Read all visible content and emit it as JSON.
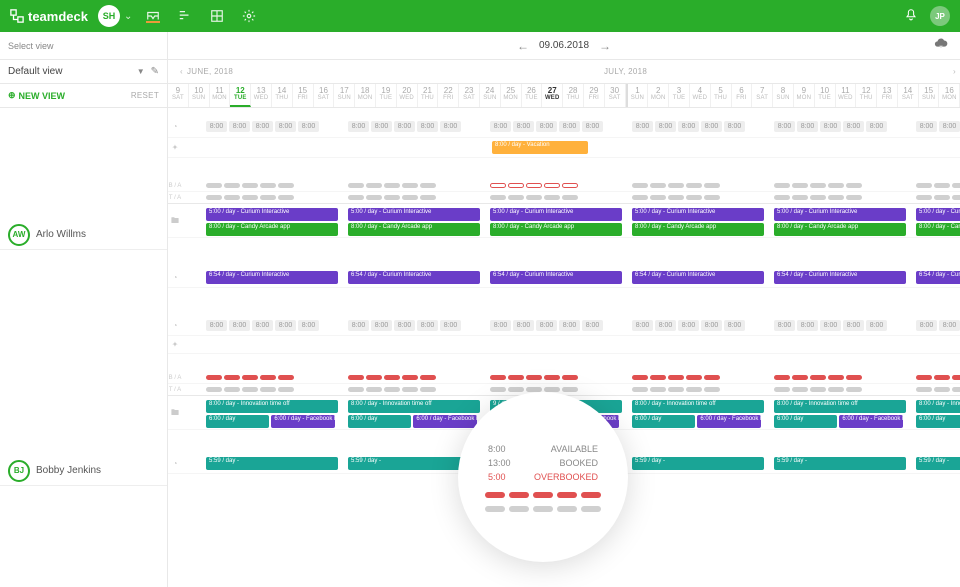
{
  "app": {
    "name": "teamdeck",
    "user_initials": "SH",
    "right_initials": "JP"
  },
  "dateNav": {
    "current": "09.06.2018"
  },
  "view": {
    "selectLabel": "Select view",
    "current": "Default view",
    "newView": "NEW VIEW",
    "reset": "RESET"
  },
  "months": {
    "june": "JUNE, 2018",
    "july": "JULY, 2018"
  },
  "days": [
    {
      "n": "9",
      "d": "SAT"
    },
    {
      "n": "10",
      "d": "SUN"
    },
    {
      "n": "11",
      "d": "MON"
    },
    {
      "n": "12",
      "d": "TUE",
      "today": true
    },
    {
      "n": "13",
      "d": "WED"
    },
    {
      "n": "14",
      "d": "THU"
    },
    {
      "n": "15",
      "d": "FRI"
    },
    {
      "n": "16",
      "d": "SAT"
    },
    {
      "n": "17",
      "d": "SUN"
    },
    {
      "n": "18",
      "d": "MON"
    },
    {
      "n": "19",
      "d": "TUE"
    },
    {
      "n": "20",
      "d": "WED"
    },
    {
      "n": "21",
      "d": "THU"
    },
    {
      "n": "22",
      "d": "FRI"
    },
    {
      "n": "23",
      "d": "SAT"
    },
    {
      "n": "24",
      "d": "SUN"
    },
    {
      "n": "25",
      "d": "MON"
    },
    {
      "n": "26",
      "d": "TUE"
    },
    {
      "n": "27",
      "d": "WED",
      "hl": true
    },
    {
      "n": "28",
      "d": "THU"
    },
    {
      "n": "29",
      "d": "FRI"
    },
    {
      "n": "30",
      "d": "SAT"
    },
    {
      "n": "1",
      "d": "SUN",
      "mstart": true
    },
    {
      "n": "2",
      "d": "MON"
    },
    {
      "n": "3",
      "d": "TUE"
    },
    {
      "n": "4",
      "d": "WED"
    },
    {
      "n": "5",
      "d": "THU"
    },
    {
      "n": "6",
      "d": "FRI"
    },
    {
      "n": "7",
      "d": "SAT"
    },
    {
      "n": "8",
      "d": "SUN"
    },
    {
      "n": "9",
      "d": "MON"
    },
    {
      "n": "10",
      "d": "TUE"
    },
    {
      "n": "11",
      "d": "WED"
    },
    {
      "n": "12",
      "d": "THU"
    },
    {
      "n": "13",
      "d": "FRI"
    },
    {
      "n": "14",
      "d": "SAT"
    },
    {
      "n": "15",
      "d": "SUN"
    },
    {
      "n": "16",
      "d": "MON"
    }
  ],
  "people": [
    {
      "initials": "AW",
      "name": "Arlo Willms",
      "color": "#2aad2a"
    },
    {
      "initials": "BJ",
      "name": "Bobby Jenkins",
      "color": "#2aad2a"
    }
  ],
  "hrs": {
    "eight": "8:00",
    "six54": "6:54",
    "six": "6:00",
    "five59": "5:59"
  },
  "bookings": {
    "curium_5": "5:00 / day - Curium Interactive",
    "curium_654": "6:54 / day - Curium Interactive",
    "candy_8": "8:00 / day - Candy Arcade app",
    "candy_8c": "8:00 / day - Can",
    "vacation": "8:00 / day - Vacation",
    "innovation_8": "8:00 / day - Innovation time off",
    "innovation_9": "9 / day - Innovation tim",
    "innovation_8c": "8:00 / day - Inno",
    "day_6": "6:00 / day",
    "fb_6": "6:00 / day - Facebook bot",
    "unk_559": "5:59 / day - "
  },
  "magnify": {
    "available_h": "8:00",
    "available_l": "AVAILABLE",
    "booked_h": "13:00",
    "booked_l": "BOOKED",
    "over_h": "5:00",
    "over_l": "OVERBOOKED"
  },
  "labels": {
    "ba": "B / A",
    "ta": "T / A"
  }
}
